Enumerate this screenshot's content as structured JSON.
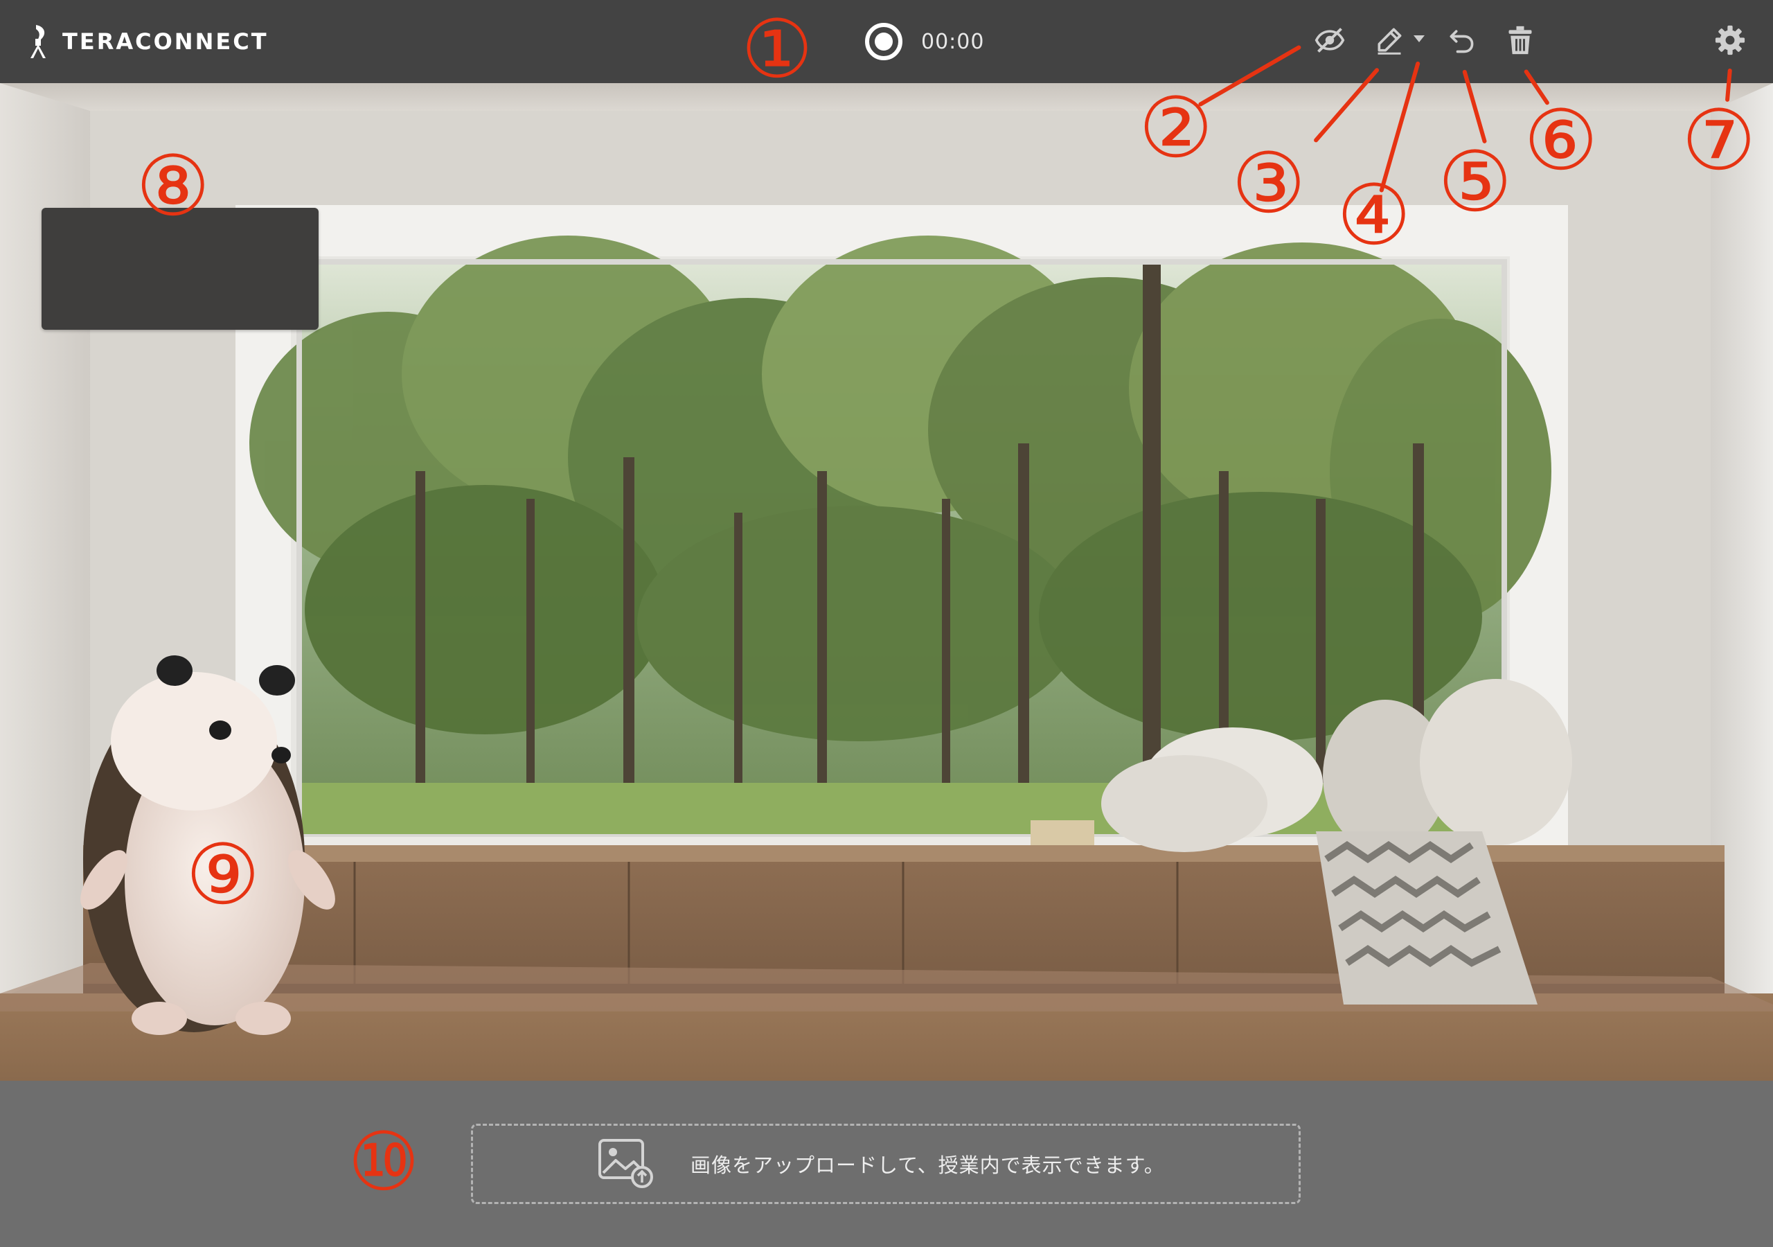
{
  "app": {
    "name": "TERACONNECT"
  },
  "recorder": {
    "time": "00:00"
  },
  "toolbar": {
    "items": [
      {
        "name": "hide-toggle",
        "icon": "eye-off-icon"
      },
      {
        "name": "pen-tool",
        "icon": "pen-icon"
      },
      {
        "name": "pen-options",
        "icon": "caret-down-icon"
      },
      {
        "name": "undo",
        "icon": "undo-icon"
      },
      {
        "name": "clear",
        "icon": "trash-icon"
      },
      {
        "name": "settings",
        "icon": "gear-icon"
      }
    ]
  },
  "upload": {
    "text": "画像をアップロードして、授業内で表示できます。",
    "icon": "image-upload-icon"
  },
  "callouts": [
    "①",
    "②",
    "③",
    "④",
    "⑤",
    "⑥",
    "⑦",
    "⑧",
    "⑨",
    "⑩"
  ],
  "colors": {
    "topbar": "#434343",
    "bottom_bar": "#6e6e6e",
    "callout": "#e63312"
  }
}
